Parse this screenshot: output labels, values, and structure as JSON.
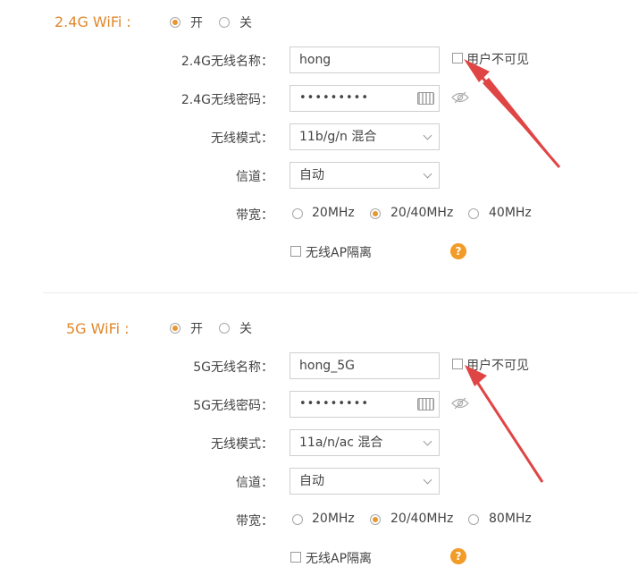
{
  "wifi24": {
    "title": "2.4G WiFi :",
    "on_label": "开",
    "off_label": "关",
    "name_label": "2.4G无线名称：",
    "name_value": "hong",
    "hide_label": "用户不可见",
    "pw_label": "2.4G无线密码：",
    "pw_value": "•••••••••",
    "mode_label": "无线模式：",
    "mode_value": "11b/g/n 混合",
    "channel_label": "信道：",
    "channel_value": "自动",
    "bw_label": "带宽：",
    "bw_options": [
      "20MHz",
      "20/40MHz",
      "40MHz"
    ],
    "bw_selected": "20/40MHz",
    "ap_isolation_label": "无线AP隔离",
    "help": "?"
  },
  "wifi5": {
    "title": "5G WiFi :",
    "on_label": "开",
    "off_label": "关",
    "name_label": "5G无线名称：",
    "name_value": "hong_5G",
    "hide_label": "用户不可见",
    "pw_label": "5G无线密码：",
    "pw_value": "•••••••••",
    "mode_label": "无线模式：",
    "mode_value": "11a/n/ac 混合",
    "channel_label": "信道：",
    "channel_value": "自动",
    "bw_label": "带宽：",
    "bw_options": [
      "20MHz",
      "20/40MHz",
      "80MHz"
    ],
    "bw_selected": "20/40MHz",
    "ap_isolation_label": "无线AP隔离",
    "help": "?"
  },
  "colors": {
    "accent": "#e0882c",
    "radio_dot": "#e8962e",
    "annotation_arrow": "#e04545"
  },
  "icons": [
    "keyboard-icon",
    "eye-hidden-icon",
    "help-icon",
    "chevron-down-icon",
    "annotation-arrow"
  ]
}
